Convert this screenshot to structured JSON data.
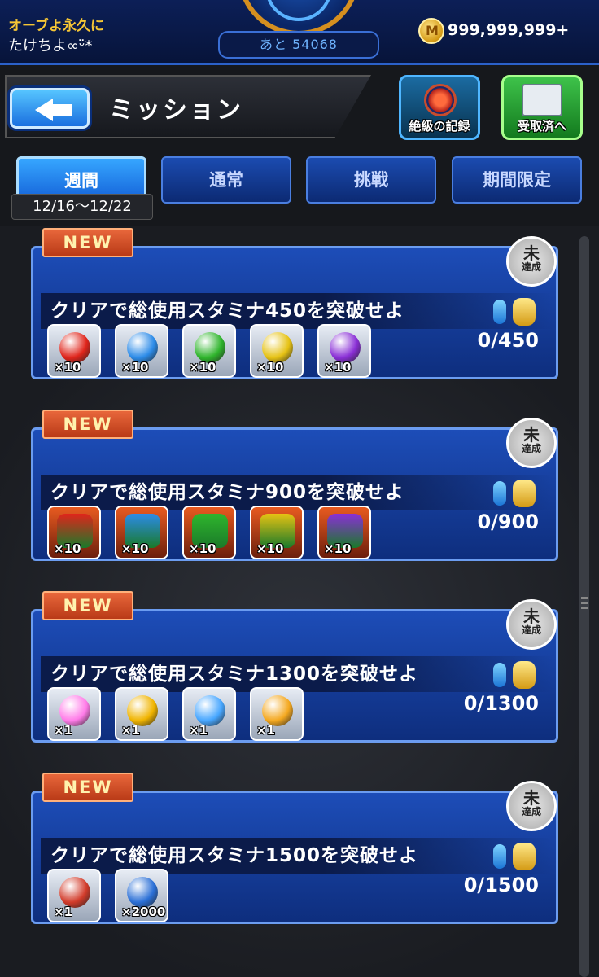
{
  "status_bar": {
    "username_line1": "オーブよ永久に",
    "username_line2": "たけちよ∞ᵕ̈*",
    "exp_remaining": "あと 54068",
    "orb_count": "999,999,999+"
  },
  "header": {
    "title": "ミッション",
    "record_button_label": "絶級の記録",
    "received_button_label": "受取済へ"
  },
  "tabs": [
    {
      "label": "週間",
      "active": true
    },
    {
      "label": "通常",
      "active": false
    },
    {
      "label": "挑戦",
      "active": false
    },
    {
      "label": "期間限定",
      "active": false
    }
  ],
  "date_range": "12/16～12/22",
  "missions": [
    {
      "badge": "NEW",
      "status_big": "未",
      "status_small": "達成",
      "text": "クリアで総使用スタミナ450を突破せよ",
      "progress": "0/450",
      "rewards": [
        {
          "icon": "red-orb-icon",
          "color": "#e0251b",
          "qty": "×10"
        },
        {
          "icon": "blue-orb-icon",
          "color": "#2c8be8",
          "qty": "×10"
        },
        {
          "icon": "green-orb-icon",
          "color": "#2fb52c",
          "qty": "×10"
        },
        {
          "icon": "yellow-orb-icon",
          "color": "#e6c213",
          "qty": "×10"
        },
        {
          "icon": "purple-orb-icon",
          "color": "#8a2fd6",
          "qty": "×10"
        }
      ]
    },
    {
      "badge": "NEW",
      "status_big": "未",
      "status_small": "達成",
      "text": "クリアで総使用スタミナ900を突破せよ",
      "progress": "0/900",
      "rewards": [
        {
          "icon": "monster-fire-icon",
          "color": "#e0251b",
          "qty": "×10"
        },
        {
          "icon": "monster-water-icon",
          "color": "#2c8be8",
          "qty": "×10"
        },
        {
          "icon": "monster-wood-icon",
          "color": "#2fb52c",
          "qty": "×10"
        },
        {
          "icon": "monster-light-icon",
          "color": "#e6c213",
          "qty": "×10"
        },
        {
          "icon": "monster-dark-icon",
          "color": "#8a2fd6",
          "qty": "×10"
        }
      ]
    },
    {
      "badge": "NEW",
      "status_big": "未",
      "status_small": "達成",
      "text": "クリアで総使用スタミナ1300を突破せよ",
      "progress": "0/1300",
      "rewards": [
        {
          "icon": "rainbow-orb-icon",
          "color": "#ff7be8",
          "qty": "×1"
        },
        {
          "icon": "energy-can-icon",
          "color": "#f0b400",
          "qty": "×1"
        },
        {
          "icon": "flask-icon",
          "color": "#46a6ff",
          "qty": "×1"
        },
        {
          "icon": "gold-pawn-icon",
          "color": "#f4a81f",
          "qty": "×1"
        }
      ]
    },
    {
      "badge": "NEW",
      "status_big": "未",
      "status_small": "達成",
      "text": "クリアで総使用スタミナ1500を突破せよ",
      "progress": "0/1500",
      "rewards": [
        {
          "icon": "scroll-icon",
          "color": "#d23b2a",
          "qty": "×1"
        },
        {
          "icon": "blue-flame-icon",
          "color": "#2a6fd6",
          "qty": "×2000"
        }
      ]
    }
  ]
}
